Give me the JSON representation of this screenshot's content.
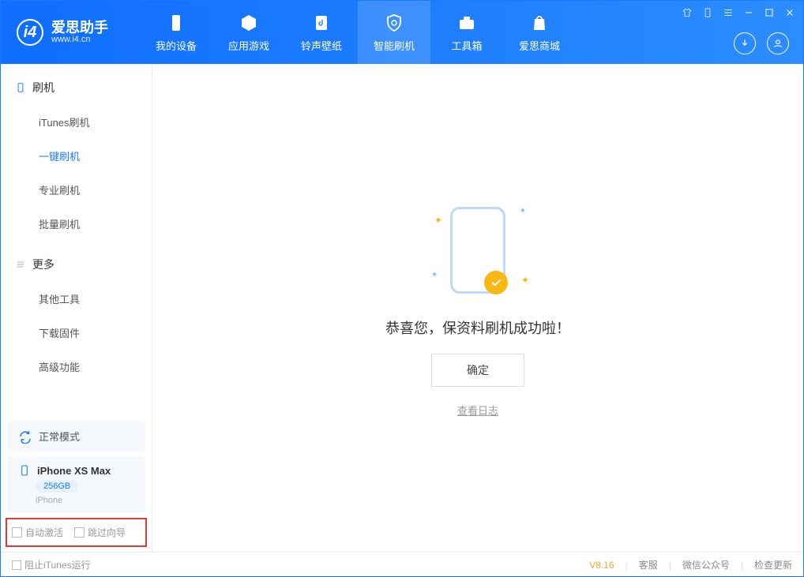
{
  "app": {
    "name": "爱思助手",
    "url": "www.i4.cn"
  },
  "tabs": [
    {
      "label": "我的设备"
    },
    {
      "label": "应用游戏"
    },
    {
      "label": "铃声壁纸"
    },
    {
      "label": "智能刷机"
    },
    {
      "label": "工具箱"
    },
    {
      "label": "爱思商城"
    }
  ],
  "sidebar": {
    "section1": {
      "title": "刷机",
      "items": [
        "iTunes刷机",
        "一键刷机",
        "专业刷机",
        "批量刷机"
      ]
    },
    "section2": {
      "title": "更多",
      "items": [
        "其他工具",
        "下载固件",
        "高级功能"
      ]
    },
    "mode": "正常模式",
    "device": {
      "name": "iPhone XS Max",
      "storage": "256GB",
      "type": "iPhone"
    },
    "checks": {
      "autoActivate": "自动激活",
      "skipGuide": "跳过向导"
    }
  },
  "main": {
    "successText": "恭喜您，保资料刷机成功啦！",
    "okButton": "确定",
    "viewLog": "查看日志"
  },
  "footer": {
    "blockItunes": "阻止iTunes运行",
    "version": "V8.16",
    "links": [
      "客服",
      "微信公众号",
      "检查更新"
    ]
  }
}
